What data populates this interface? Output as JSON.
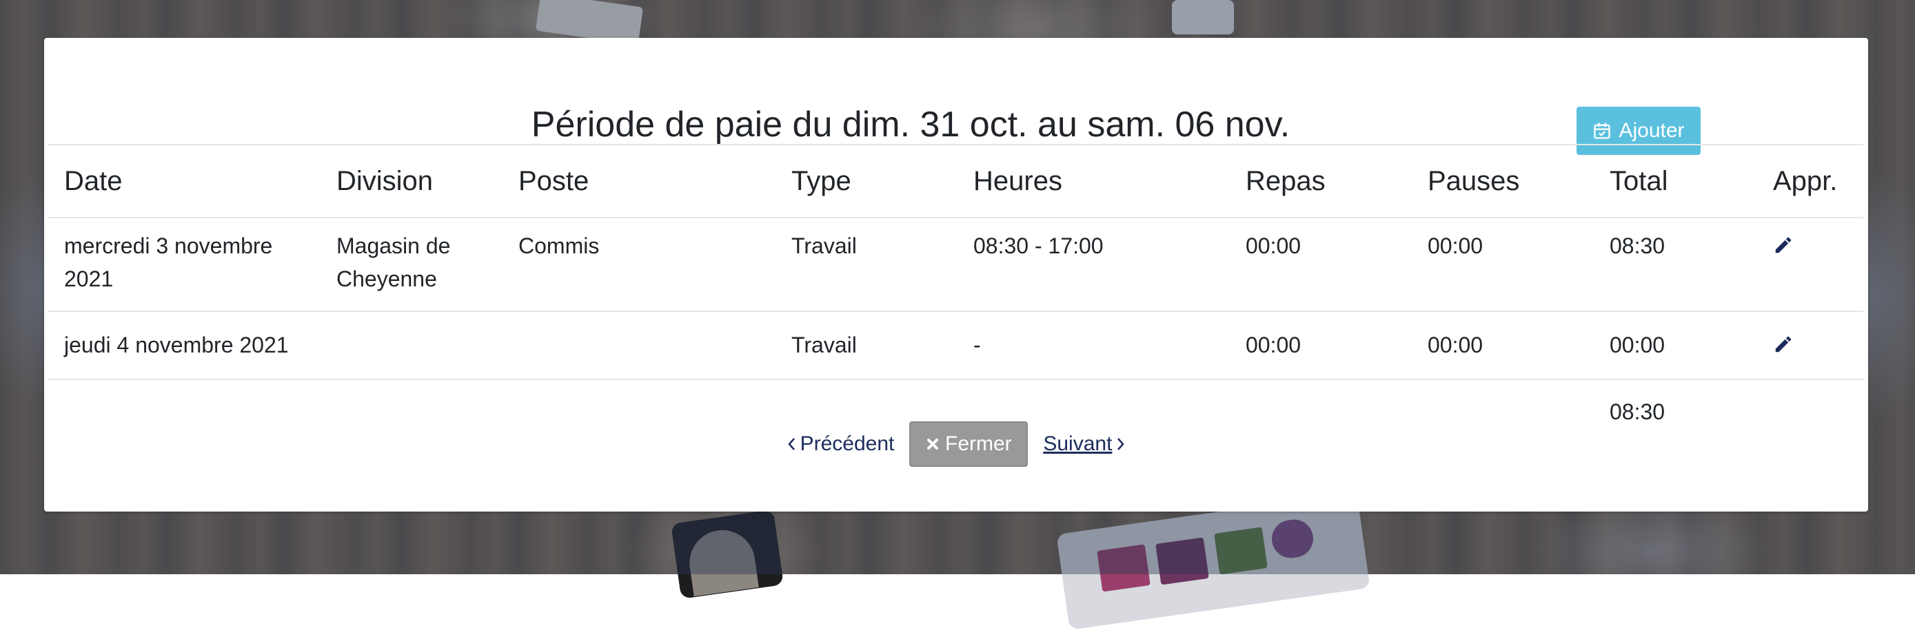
{
  "page": {
    "title": "Période de paie du dim. 31 oct. au sam. 06 nov.",
    "add_label": "Ajouter"
  },
  "table": {
    "headers": [
      "Date",
      "Division",
      "Poste",
      "Type",
      "Heures",
      "Repas",
      "Pauses",
      "Total",
      "Appr."
    ],
    "rows": [
      {
        "date": "mercredi 3 novembre 2021",
        "division": "Magasin de Cheyenne",
        "poste": "Commis",
        "type": "Travail",
        "heures": "08:30 - 17:00",
        "repas": "00:00",
        "pauses": "00:00",
        "total": "08:30"
      },
      {
        "date": "jeudi 4 novembre 2021",
        "division": "",
        "poste": "",
        "type": "Travail",
        "heures": "-",
        "repas": "00:00",
        "pauses": "00:00",
        "total": "00:00"
      }
    ],
    "grand_total": "08:30"
  },
  "pager": {
    "prev_label": "Précédent",
    "close_label": "Fermer",
    "next_label": "Suivant"
  },
  "colors": {
    "add_button": "#5bc0de",
    "close_button": "#999999",
    "link": "#1b2c5c",
    "edit_icon": "#1b2c5c"
  },
  "icons": {
    "add": "calendar-check-icon",
    "edit": "pencil-icon",
    "prev": "chevron-left-icon",
    "next": "chevron-right-icon",
    "close": "times-icon"
  }
}
